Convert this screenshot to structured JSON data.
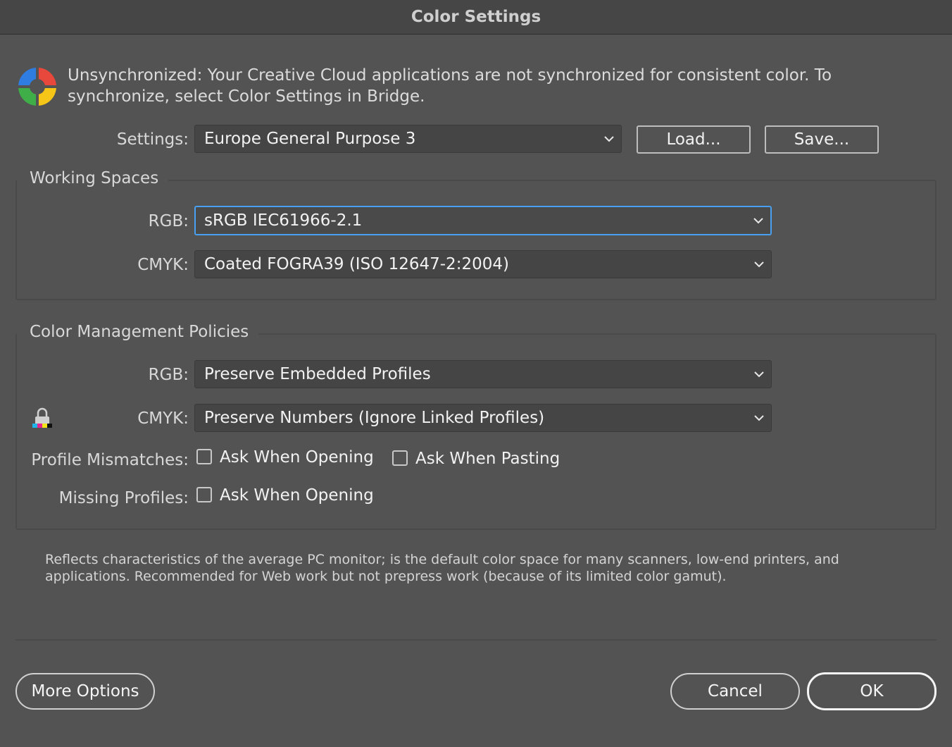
{
  "window": {
    "title": "Color Settings"
  },
  "sync": {
    "message": "Unsynchronized: Your Creative Cloud applications are not synchronized for consistent color. To synchronize, select Color Settings in Bridge.",
    "icon": "color-wheel-icon"
  },
  "settings": {
    "label": "Settings:",
    "value": "Europe General Purpose 3",
    "load_label": "Load...",
    "save_label": "Save..."
  },
  "working_spaces": {
    "title": "Working Spaces",
    "rgb_label": "RGB:",
    "rgb_value": "sRGB IEC61966-2.1",
    "cmyk_label": "CMYK:",
    "cmyk_value": "Coated FOGRA39 (ISO 12647-2:2004)"
  },
  "policies": {
    "title": "Color Management Policies",
    "rgb_label": "RGB:",
    "rgb_value": "Preserve Embedded Profiles",
    "cmyk_label": "CMYK:",
    "cmyk_value": "Preserve Numbers (Ignore Linked Profiles)",
    "mismatch_label": "Profile Mismatches:",
    "mismatch_opening": "Ask When Opening",
    "mismatch_pasting": "Ask When Pasting",
    "missing_label": "Missing Profiles:",
    "missing_opening": "Ask When Opening"
  },
  "description": "Reflects characteristics of the average PC monitor; is the default color space for many scanners, low-end printers, and applications. Recommended for Web work but not prepress work (because of its limited color gamut).",
  "footer": {
    "more_options": "More Options",
    "cancel": "Cancel",
    "ok": "OK"
  },
  "colors": {
    "background": "#535353",
    "focus": "#4aa0f0",
    "titlebar": "#464646"
  }
}
